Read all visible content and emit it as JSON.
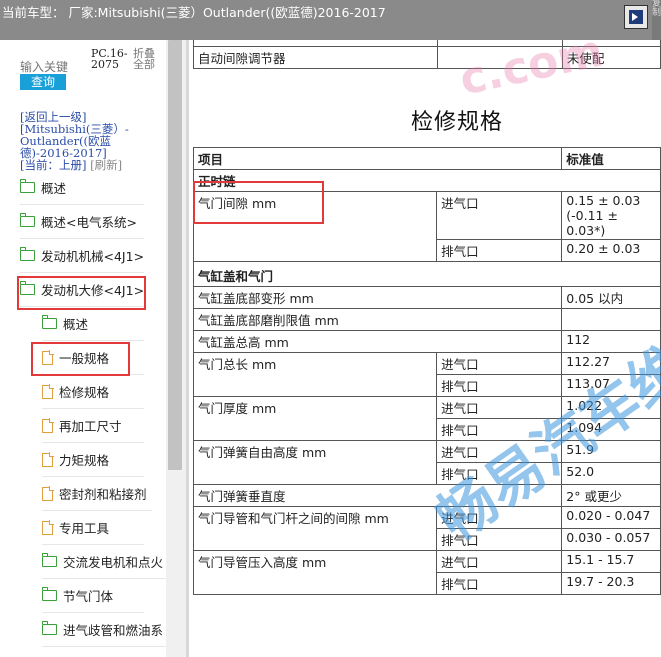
{
  "topbar": {
    "title": "当前车型：  厂家:Mitsubishi(三菱）Outlander((欧蓝德)2016-2017",
    "side_strip": "复制"
  },
  "sidebar": {
    "search_placeholder": "输入关键",
    "search_button": "查询",
    "pc_label": "PC.16-2075",
    "fold_label": "折叠全部",
    "nav": {
      "back": "[返回上一级]",
      "model": "[Mitsubishi(三菱）- Outlander((欧蓝德)-2016-2017]",
      "current": "[当前：上册]",
      "refresh": "[刷新]"
    },
    "items": [
      {
        "label": "概述",
        "icon": "folder-icon"
      },
      {
        "label": "概述<电气系统>",
        "icon": "folder-icon"
      },
      {
        "label": "发动机机械<4J1>",
        "icon": "folder-icon"
      },
      {
        "label": "发动机大修<4J1>",
        "icon": "folder-icon"
      },
      {
        "label": "概述",
        "icon": "folder-icon"
      },
      {
        "label": "一般规格",
        "icon": "file-icon"
      },
      {
        "label": "检修规格",
        "icon": "file-icon"
      },
      {
        "label": "再加工尺寸",
        "icon": "file-icon"
      },
      {
        "label": "力矩规格",
        "icon": "file-icon"
      },
      {
        "label": "密封剂和粘接剂",
        "icon": "file-icon"
      },
      {
        "label": "专用工具",
        "icon": "file-icon"
      },
      {
        "label": "交流发电机和点火",
        "icon": "folder-icon"
      },
      {
        "label": "节气门体",
        "icon": "folder-icon"
      },
      {
        "label": "进气歧管和燃油系",
        "icon": "folder-icon"
      }
    ]
  },
  "content": {
    "pre_row": {
      "item": "自动间隙调节器",
      "value": "未使配"
    },
    "title": "检修规格",
    "headers": {
      "item": "项目",
      "value": "标准值"
    },
    "sections": {
      "timing": "正时链",
      "valve_intake_label": "气门间隙 mm",
      "cylinder": "气缸盖和气门"
    },
    "rows": {
      "gap_in_sub": "进气口",
      "gap_in_val": "0.15 ± 0.03",
      "gap_in_val2": "(-0.11 ± 0.03*)",
      "gap_ex_sub": "排气口",
      "gap_ex_val": "0.20 ± 0.03",
      "warp": "气缸盖底部变形 mm",
      "warp_val": "0.05 以内",
      "grind": "气缸盖底部磨削限值 mm",
      "grind_val": "",
      "height": "气缸盖总高 mm",
      "height_val": "112",
      "vlen": "气门总长 mm",
      "vlen_in_sub": "进气口",
      "vlen_in_val": "112.27",
      "vlen_ex_sub": "排气口",
      "vlen_ex_val": "113.07",
      "vthick": "气门厚度 mm",
      "vthick_in_sub": "进气口",
      "vthick_in_val": "1.022",
      "vthick_ex_sub": "排气口",
      "vthick_ex_val": "1.094",
      "spring": "气门弹簧自由高度 mm",
      "spring_in_sub": "进气口",
      "spring_in_val": "51.9",
      "spring_ex_sub": "排气口",
      "spring_ex_val": "52.0",
      "perp": "气门弹簧垂直度",
      "perp_val": "2° 或更少",
      "guide_gap": "气门导管和气门杆之间的间隙 mm",
      "guide_gap_in_sub": "进气口",
      "guide_gap_in_val": "0.020 - 0.047",
      "guide_gap_ex_sub": "排气口",
      "guide_gap_ex_val": "0.030 - 0.057",
      "guide_h": "气门导管压入高度 mm",
      "guide_h_in_sub": "进气口",
      "guide_h_in_val": "15.1 - 15.7",
      "guide_h_ex_sub": "排气口",
      "guide_h_ex_val": "19.7 - 20.3"
    },
    "watermark": "畅易汽车维",
    "watermark_url": "c.com"
  },
  "colors": {
    "accent_blue": "#1aa0d8",
    "highlight_red": "#e23a3a",
    "folder_green": "#3aa13a",
    "file_orange": "#e0a040",
    "topbar_gray": "#8a8a8a"
  }
}
